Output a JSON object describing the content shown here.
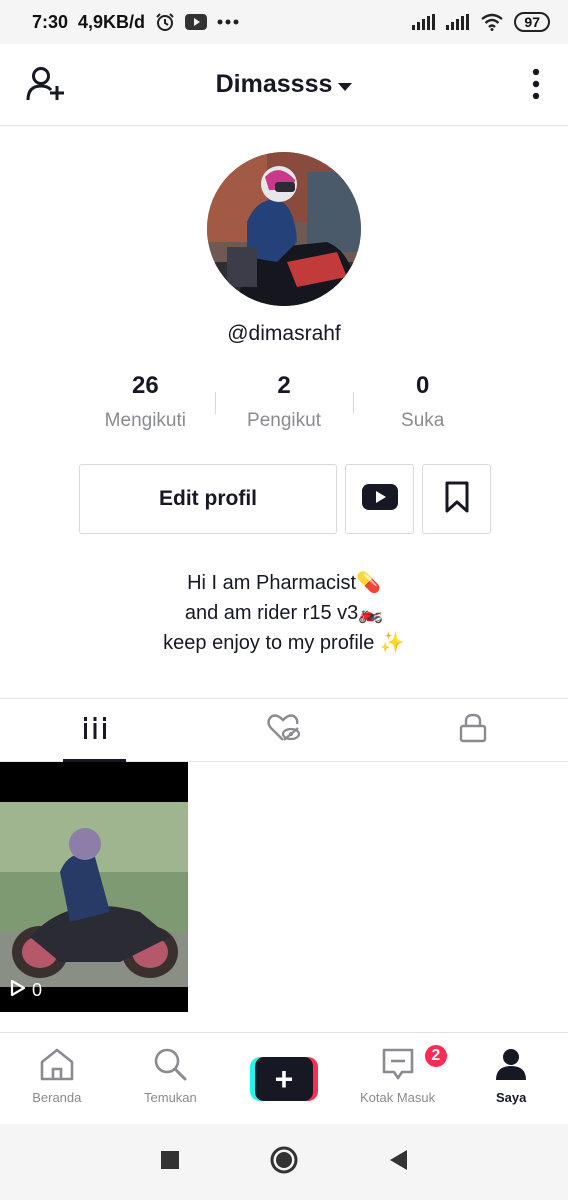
{
  "status_bar": {
    "time": "7:30",
    "network_speed": "4,9KB/d",
    "battery": "97",
    "icons": [
      "alarm-icon",
      "youtube-icon",
      "more-dots-icon",
      "signal-icon",
      "signal-icon",
      "wifi-icon",
      "battery-icon"
    ]
  },
  "header": {
    "username_title": "Dimassss",
    "icons": [
      "add-user-icon",
      "dropdown-caret-icon",
      "more-vertical-icon"
    ]
  },
  "profile": {
    "handle": "@dimasrahf",
    "stats": [
      {
        "value": "26",
        "label": "Mengikuti"
      },
      {
        "value": "2",
        "label": "Pengikut"
      },
      {
        "value": "0",
        "label": "Suka"
      }
    ],
    "edit_button": "Edit profil",
    "bio": [
      "Hi I am Pharmacist💊",
      "and am rider r15 v3🏍️",
      "keep enjoy to my profile ✨"
    ]
  },
  "tabs": [
    "videos-grid-icon",
    "liked-hidden-icon",
    "lock-icon"
  ],
  "videos": [
    {
      "views": "0"
    }
  ],
  "bottom_nav": [
    {
      "label": "Beranda",
      "icon": "home-icon"
    },
    {
      "label": "Temukan",
      "icon": "search-icon"
    },
    {
      "label": "",
      "icon": "plus-icon"
    },
    {
      "label": "Kotak Masuk",
      "icon": "inbox-icon",
      "badge": "2"
    },
    {
      "label": "Saya",
      "icon": "profile-icon"
    }
  ],
  "colors": {
    "accent_red": "#fe2c55",
    "accent_cyan": "#25f4ee",
    "text_dark": "#161823",
    "text_gray": "#8a8b91"
  }
}
